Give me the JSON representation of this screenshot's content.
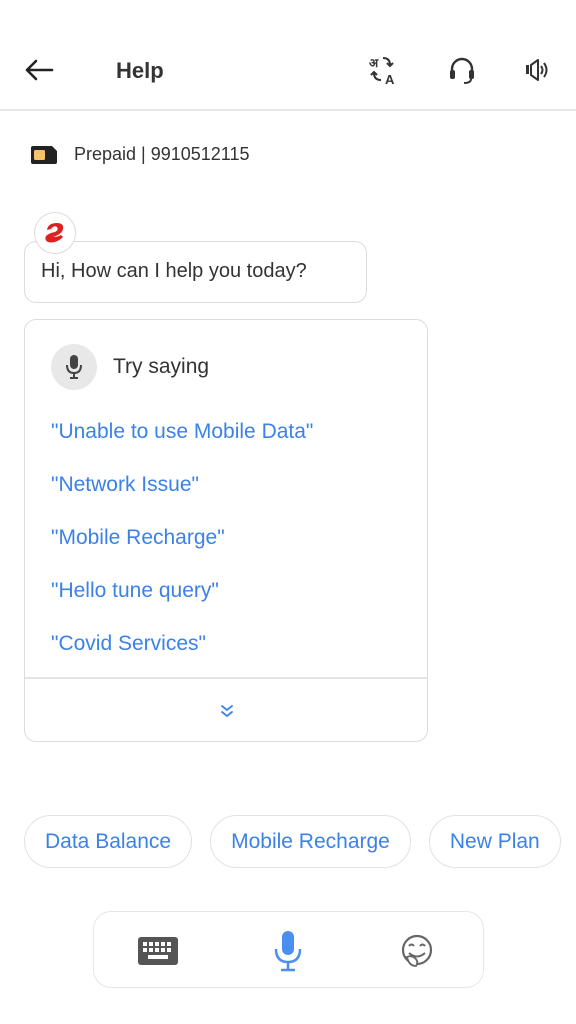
{
  "header": {
    "title": "Help",
    "icons": [
      "back-arrow-icon",
      "translate-icon",
      "headset-icon",
      "speaker-icon"
    ]
  },
  "account": {
    "text": "Prepaid | 9910512115",
    "sim_icon": "sim-card-icon"
  },
  "chat": {
    "bot_avatar": "airtel-logo-icon",
    "greeting": "Hi, How can I help you today?"
  },
  "suggestions_card": {
    "header_label": "Try saying",
    "items": [
      "\"Unable to use Mobile Data\"",
      "\"Network Issue\"",
      "\"Mobile Recharge\"",
      "\"Hello tune query\"",
      "\"Covid Services\""
    ],
    "expand_icon": "double-chevron-down-icon"
  },
  "quick_chips": [
    "Data Balance",
    "Mobile Recharge",
    "New Plan"
  ],
  "input_bar": {
    "icons": [
      "keyboard-icon",
      "microphone-icon",
      "emoji-icon"
    ]
  },
  "colors": {
    "accent_blue": "#3b82e8",
    "airtel_red": "#e02020",
    "text_dark": "#333333",
    "border": "#dcdcdc"
  }
}
